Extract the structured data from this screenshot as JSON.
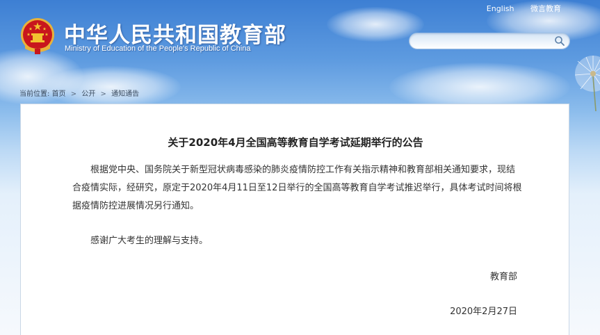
{
  "header": {
    "site_title": "中华人民共和国教育部",
    "site_subtitle": "Ministry of Education of the People's Republic of China",
    "top_links": [
      "English",
      "微言教育"
    ],
    "search": {
      "value": "",
      "placeholder": "",
      "icon": "search-icon"
    }
  },
  "breadcrumb": {
    "prefix": "当前位置:",
    "items": [
      "首页",
      "公开",
      "通知通告"
    ],
    "separator": ">"
  },
  "article": {
    "title": "关于2020年4月全国高等教育自学考试延期举行的公告",
    "paragraphs": [
      "根据党中央、国务院关于新型冠状病毒感染的肺炎疫情防控工作有关指示精神和教育部相关通知要求，现结合疫情实际，经研究，原定于2020年4月11日至12日举行的全国高等教育自学考试推迟举行，具体考试时间将根据疫情防控进展情况另行通知。",
      "感谢广大考生的理解与支持。"
    ],
    "signature": "教育部",
    "date": "2020年2月27日"
  },
  "colors": {
    "sky_top": "#3d7fd3",
    "panel_bg": "#ffffff",
    "text": "#333333",
    "emblem_red": "#c8161d",
    "emblem_gold": "#f2c230"
  }
}
